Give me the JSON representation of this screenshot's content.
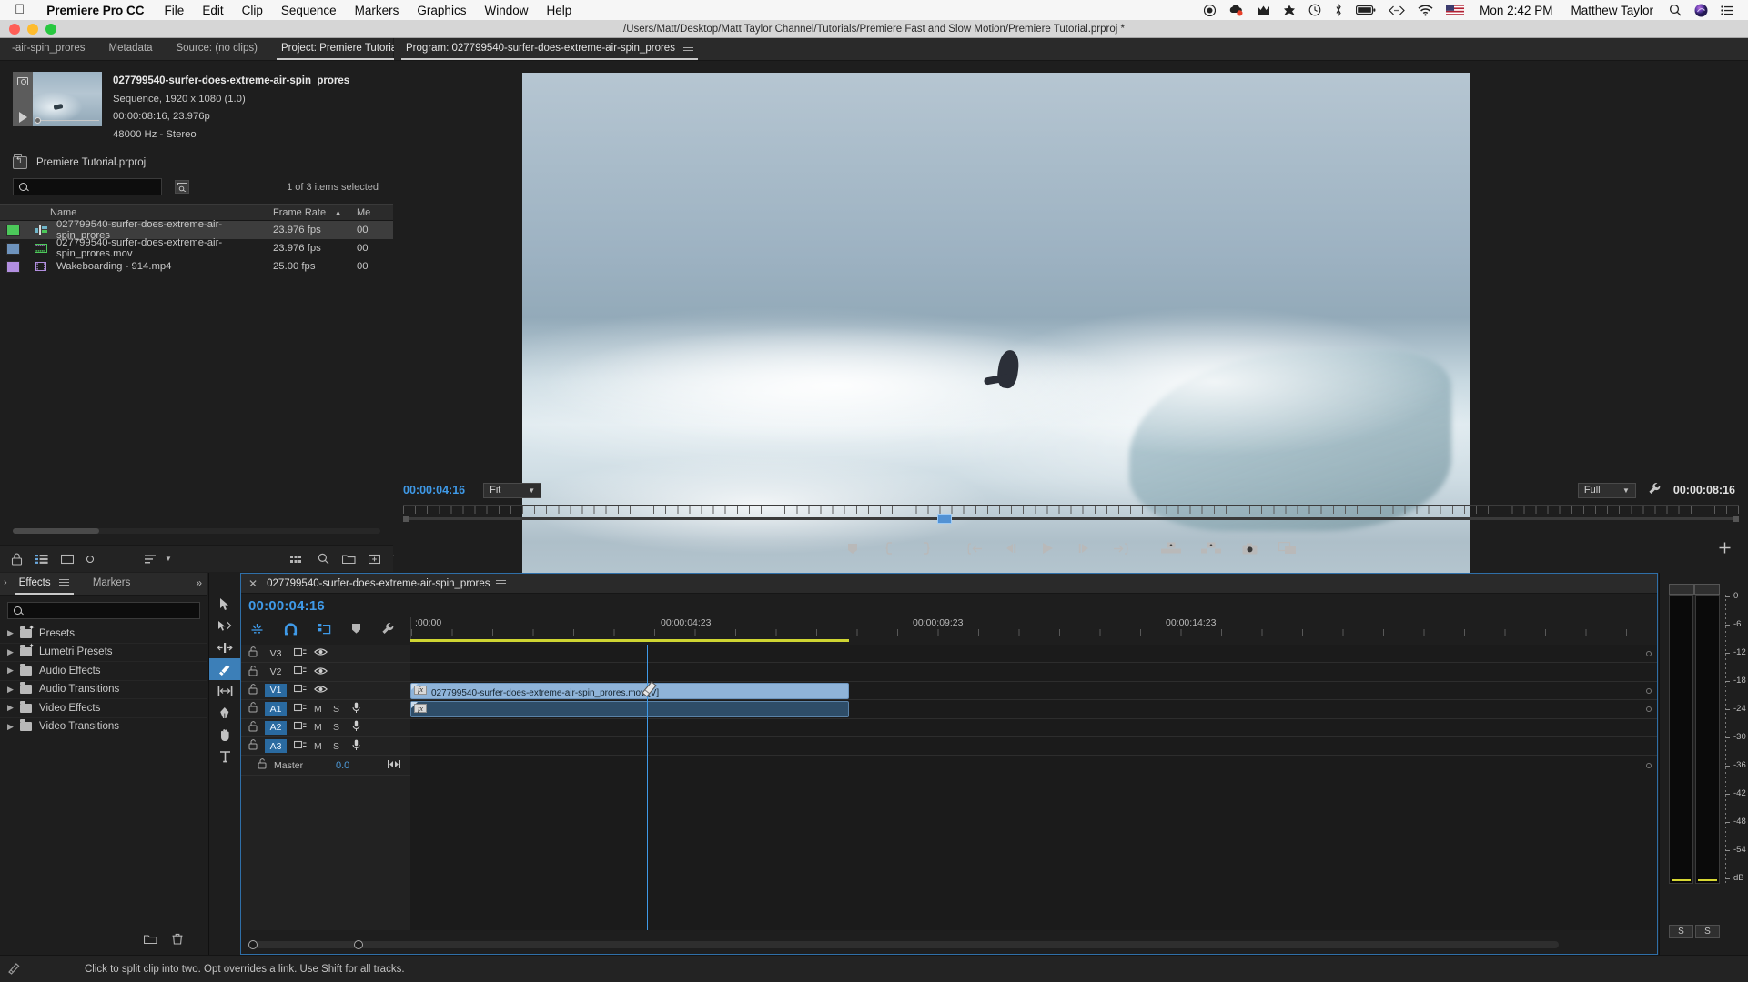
{
  "macmenu": {
    "apple_icon": "apple-icon",
    "app_name": "Premiere Pro CC",
    "items": [
      "File",
      "Edit",
      "Clip",
      "Sequence",
      "Markers",
      "Graphics",
      "Window",
      "Help"
    ],
    "status_icons": [
      "record-icon",
      "creative-cloud-icon",
      "malwarebytes-icon",
      "app-icon",
      "time-machine-icon",
      "bluetooth-icon",
      "battery-icon",
      "code-icon",
      "wifi-icon",
      "flag-us-icon"
    ],
    "time": "Mon 2:42 PM",
    "user": "Matthew Taylor",
    "search_icon": "spotlight-search-icon",
    "siri_icon": "siri-icon",
    "notification_icon": "notification-center-icon"
  },
  "titlebar": {
    "path": "/Users/Matt/Desktop/Matt Taylor Channel/Tutorials/Premiere Fast and Slow Motion/Premiere Tutorial.prproj *"
  },
  "project_panel": {
    "tabs": [
      {
        "label": "-air-spin_prores",
        "active": false
      },
      {
        "label": "Metadata",
        "active": false
      },
      {
        "label": "Source: (no clips)",
        "active": false
      },
      {
        "label": "Project: Premiere Tutorial",
        "active": true
      }
    ],
    "expand_icon": "chevrons-right-icon",
    "preview": {
      "title": "027799540-surfer-does-extreme-air-spin_prores",
      "line2": "Sequence, 1920 x 1080 (1.0)",
      "line3": "00:00:08:16, 23.976p",
      "line4": "48000 Hz - Stereo"
    },
    "bin_name": "Premiere Tutorial.prproj",
    "search_placeholder": "",
    "search_value": "",
    "selection_status": "1 of 3 items selected",
    "columns": [
      "Name",
      "Frame Rate",
      "Me"
    ],
    "sort_indicator": "▲",
    "rows": [
      {
        "color": "#4cc85a",
        "icon": "sequence-icon",
        "name": "027799540-surfer-does-extreme-air-spin_prores",
        "frame_rate": "23.976 fps",
        "media": "00",
        "selected": true
      },
      {
        "color": "#6e93bd",
        "icon": "movie-clip-icon",
        "name": "027799540-surfer-does-extreme-air-spin_prores.mov",
        "frame_rate": "23.976 fps",
        "media": "00",
        "selected": false
      },
      {
        "color": "#b28fe0",
        "icon": "film-clip-icon",
        "name": "Wakeboarding - 914.mp4",
        "frame_rate": "25.00 fps",
        "media": "00",
        "selected": false
      }
    ],
    "footer_icons": [
      "lock-icon",
      "list-view-icon",
      "icon-view-icon",
      "zoom-slider",
      "sort-icon",
      "freeform-icon",
      "find-icon",
      "new-bin-icon",
      "new-item-icon",
      "delete-icon"
    ]
  },
  "program_panel": {
    "tab_label": "Program: 027799540-surfer-does-extreme-air-spin_prores",
    "menu_icon": "hamburger-icon",
    "current_timecode": "00:00:04:16",
    "fit_label": "Fit",
    "quality_label": "Full",
    "wrench_icon": "settings-wrench-icon",
    "duration_timecode": "00:00:08:16",
    "controls": [
      {
        "icon": "add-marker-icon"
      },
      {
        "icon": "mark-in-icon"
      },
      {
        "icon": "mark-out-icon"
      },
      {
        "icon": "go-to-in-icon"
      },
      {
        "icon": "step-back-icon"
      },
      {
        "icon": "play-icon"
      },
      {
        "icon": "step-forward-icon"
      },
      {
        "icon": "go-to-out-icon"
      },
      {
        "icon": "lift-icon"
      },
      {
        "icon": "extract-icon"
      },
      {
        "icon": "export-frame-icon"
      },
      {
        "icon": "comparison-view-icon"
      }
    ],
    "plus_icon": "button-editor-plus-icon"
  },
  "effects_panel": {
    "tabs": [
      {
        "label": "Effects",
        "active": true
      },
      {
        "label": "Markers",
        "active": false
      }
    ],
    "menu_icon": "hamburger-icon",
    "expand_icon": "chevrons-right-icon",
    "search_placeholder": "",
    "search_value": "",
    "items": [
      {
        "label": "Presets",
        "icon": "preset-folder-icon"
      },
      {
        "label": "Lumetri Presets",
        "icon": "preset-folder-icon"
      },
      {
        "label": "Audio Effects",
        "icon": "folder-icon"
      },
      {
        "label": "Audio Transitions",
        "icon": "folder-icon"
      },
      {
        "label": "Video Effects",
        "icon": "folder-icon"
      },
      {
        "label": "Video Transitions",
        "icon": "folder-icon"
      }
    ],
    "footer_icons": [
      "new-custom-bin-icon",
      "delete-icon"
    ]
  },
  "tools": [
    {
      "icon": "selection-tool-icon",
      "active": false
    },
    {
      "icon": "track-select-forward-icon",
      "active": false
    },
    {
      "icon": "ripple-edit-icon",
      "active": false
    },
    {
      "icon": "razor-tool-icon",
      "active": true
    },
    {
      "icon": "slip-tool-icon",
      "active": false
    },
    {
      "icon": "pen-tool-icon",
      "active": false
    },
    {
      "icon": "hand-tool-icon",
      "active": false
    },
    {
      "icon": "type-tool-icon",
      "active": false
    }
  ],
  "timeline": {
    "tab_label": "027799540-surfer-does-extreme-air-spin_prores",
    "close_icon": "close-x-icon",
    "menu_icon": "hamburger-icon",
    "current_timecode": "00:00:04:16",
    "tool_icons": [
      "insert-overwrite-icon",
      "snap-magnet-icon",
      "linked-selection-icon",
      "add-marker-icon",
      "timeline-settings-wrench-icon"
    ],
    "ruler_labels": [
      ":00:00",
      "00:00:04:23",
      "00:00:09:23",
      "00:00:14:23"
    ],
    "tracks": [
      {
        "name": "V3",
        "type": "video",
        "targeted": false,
        "lock": "unlocked",
        "sync_icon": "track-target-icon",
        "eye_icon": "eye-icon"
      },
      {
        "name": "V2",
        "type": "video",
        "targeted": false,
        "lock": "unlocked",
        "sync_icon": "track-target-icon",
        "eye_icon": "eye-icon"
      },
      {
        "name": "V1",
        "type": "video",
        "targeted": true,
        "lock": "unlocked",
        "sync_icon": "track-target-icon",
        "eye_icon": "eye-icon"
      },
      {
        "name": "A1",
        "type": "audio",
        "targeted": true,
        "lock": "unlocked",
        "mute": "M",
        "solo": "S",
        "mic_icon": "microphone-icon"
      },
      {
        "name": "A2",
        "type": "audio",
        "targeted": true,
        "lock": "unlocked",
        "mute": "M",
        "solo": "S",
        "mic_icon": "microphone-icon"
      },
      {
        "name": "A3",
        "type": "audio",
        "targeted": true,
        "lock": "unlocked",
        "mute": "M",
        "solo": "S",
        "mic_icon": "microphone-icon"
      }
    ],
    "master": {
      "name": "Master",
      "value": "0.0",
      "lock": "unlocked",
      "meter_icon": "master-meter-icon"
    },
    "clip": {
      "label": "027799540-surfer-does-extreme-air-spin_prores.mov [V]",
      "fx_badge": "fx"
    },
    "cursor_icon": "razor-cursor-icon"
  },
  "meters": {
    "scale": [
      "0",
      "-6",
      "-12",
      "-18",
      "-24",
      "-30",
      "-36",
      "-42",
      "-48",
      "-54",
      "dB"
    ],
    "solo_buttons": [
      "S",
      "S"
    ]
  },
  "statusbar": {
    "icon": "razor-tool-icon",
    "text": "Click to split clip into two. Opt overrides a link. Use Shift for all tracks."
  },
  "colors": {
    "accent_blue": "#3f9ae8",
    "target_blue": "#2a6aa0",
    "clip_video": "#8fb4d9",
    "work_area": "#cfd532"
  }
}
